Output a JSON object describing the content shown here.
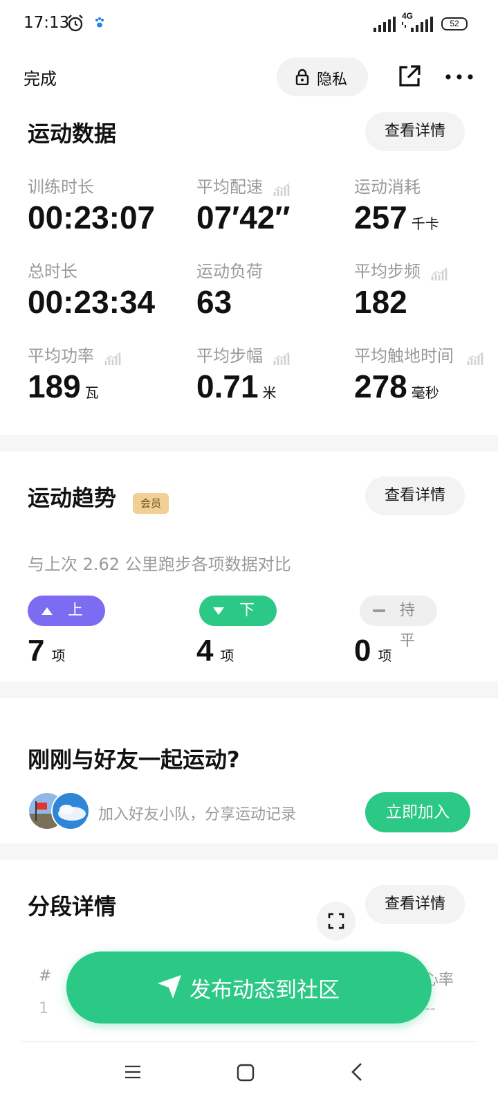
{
  "status_bar": {
    "time": "17:13",
    "network": "4G",
    "battery": "52",
    "icons": [
      "alarm-icon",
      "paw-icon",
      "signal-icon",
      "signal-icon"
    ]
  },
  "header": {
    "done_label": "完成",
    "privacy_label": "隐私",
    "icons": [
      "lock-icon",
      "share-icon",
      "more-icon"
    ]
  },
  "workout": {
    "title": "运动数据",
    "detail_label": "查看详情",
    "metrics": [
      {
        "label": "训练时长",
        "value": "00:23:07",
        "unit": ""
      },
      {
        "label": "平均配速",
        "value": "07′42″",
        "unit": ""
      },
      {
        "label": "运动消耗",
        "value": "257",
        "unit": "千卡"
      },
      {
        "label": "总时长",
        "value": "00:23:34",
        "unit": ""
      },
      {
        "label": "运动负荷",
        "value": "63",
        "unit": ""
      },
      {
        "label": "平均步频",
        "value": "182",
        "unit": ""
      },
      {
        "label": "平均功率",
        "value": "189",
        "unit": "瓦"
      },
      {
        "label": "平均步幅",
        "value": "0.71",
        "unit": "米"
      },
      {
        "label": "平均触地时间",
        "value": "278",
        "unit": "毫秒"
      }
    ]
  },
  "trend": {
    "title": "运动趋势",
    "vip_badge": "会员",
    "detail_label": "查看详情",
    "compare_text": "与上次 2.62 公里跑步各项数据对比",
    "items": [
      {
        "label": "上升",
        "count": "7",
        "unit": "项",
        "color": "#7b6cf2"
      },
      {
        "label": "下降",
        "count": "4",
        "unit": "项",
        "color": "#2bc886"
      },
      {
        "label": "持平",
        "count": "0",
        "unit": "项",
        "color": "#efefef"
      }
    ]
  },
  "friends": {
    "title": "刚刚与好友一起运动?",
    "text": "加入好友小队，分享运动记录",
    "join_label": "立即加入"
  },
  "segments": {
    "title": "分段详情",
    "detail_label": "查看详情",
    "columns": [
      "#",
      "心率"
    ],
    "row": {
      "index": "1",
      "heart_rate": "--"
    }
  },
  "publish": {
    "label": "发布动态到社区"
  },
  "nav": {
    "icons": [
      "menu-icon",
      "home-icon",
      "back-icon"
    ]
  },
  "colors": {
    "accent_green": "#2bc886",
    "accent_purple": "#7b6cf2",
    "vip_gold": "#f2cf95"
  }
}
